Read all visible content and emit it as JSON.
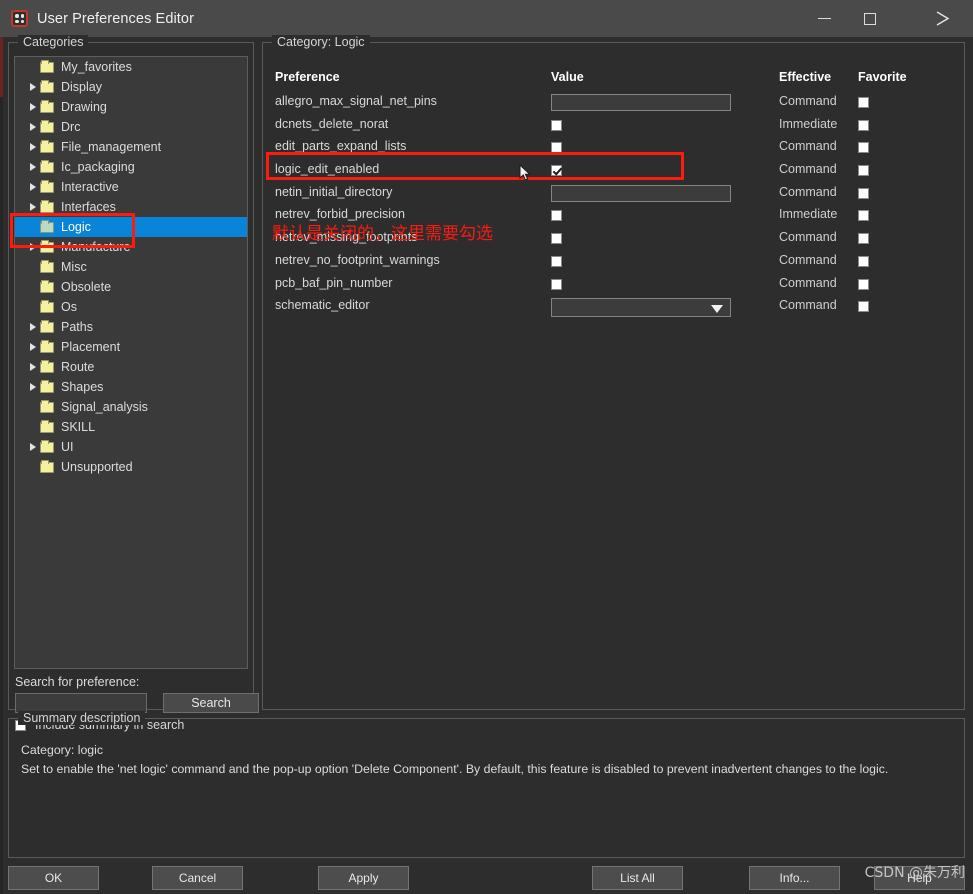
{
  "window": {
    "title": "User Preferences Editor",
    "icon": "app-preferences-icon",
    "minimize": "−",
    "maximize": "□",
    "close": "✕"
  },
  "categories_panel": {
    "legend": "Categories",
    "tree": [
      {
        "label": "My_favorites",
        "expandable": false,
        "selected": false
      },
      {
        "label": "Display",
        "expandable": true,
        "selected": false
      },
      {
        "label": "Drawing",
        "expandable": true,
        "selected": false
      },
      {
        "label": "Drc",
        "expandable": true,
        "selected": false
      },
      {
        "label": "File_management",
        "expandable": true,
        "selected": false
      },
      {
        "label": "Ic_packaging",
        "expandable": true,
        "selected": false
      },
      {
        "label": "Interactive",
        "expandable": true,
        "selected": false
      },
      {
        "label": "Interfaces",
        "expandable": true,
        "selected": false
      },
      {
        "label": "Logic",
        "expandable": false,
        "selected": true
      },
      {
        "label": "Manufacture",
        "expandable": true,
        "selected": false
      },
      {
        "label": "Misc",
        "expandable": false,
        "selected": false
      },
      {
        "label": "Obsolete",
        "expandable": false,
        "selected": false
      },
      {
        "label": "Os",
        "expandable": false,
        "selected": false
      },
      {
        "label": "Paths",
        "expandable": true,
        "selected": false
      },
      {
        "label": "Placement",
        "expandable": true,
        "selected": false
      },
      {
        "label": "Route",
        "expandable": true,
        "selected": false
      },
      {
        "label": "Shapes",
        "expandable": true,
        "selected": false
      },
      {
        "label": "Signal_analysis",
        "expandable": false,
        "selected": false
      },
      {
        "label": "SKILL",
        "expandable": false,
        "selected": false
      },
      {
        "label": "UI",
        "expandable": true,
        "selected": false
      },
      {
        "label": "Unsupported",
        "expandable": false,
        "selected": false
      }
    ],
    "search_label": "Search for preference:",
    "search_value": "",
    "search_placeholder": "",
    "search_button": "Search",
    "include_summary_label": "Include summary in search",
    "include_summary_checked": false
  },
  "category_panel": {
    "legend_prefix": "Category:",
    "legend_value": "Logic",
    "legend": "Category:   Logic",
    "columns": {
      "preference": "Preference",
      "value": "Value",
      "effective": "Effective",
      "favorite": "Favorite"
    },
    "rows": [
      {
        "name": "allegro_max_signal_net_pins",
        "value_type": "text",
        "value": "",
        "effective": "Command",
        "favorite": false,
        "highlighted": false
      },
      {
        "name": "dcnets_delete_norat",
        "value_type": "checkbox",
        "checked": false,
        "effective": "Immediate",
        "favorite": false,
        "highlighted": false
      },
      {
        "name": "edit_parts_expand_lists",
        "value_type": "checkbox",
        "checked": false,
        "effective": "Command",
        "favorite": false,
        "highlighted": false
      },
      {
        "name": "logic_edit_enabled",
        "value_type": "checkbox",
        "checked": true,
        "effective": "Command",
        "favorite": false,
        "highlighted": true
      },
      {
        "name": "netin_initial_directory",
        "value_type": "text",
        "value": "",
        "effective": "Command",
        "favorite": false,
        "highlighted": false
      },
      {
        "name": "netrev_forbid_precision",
        "value_type": "checkbox",
        "checked": false,
        "effective": "Immediate",
        "favorite": false,
        "highlighted": false
      },
      {
        "name": "netrev_missing_footprints",
        "value_type": "checkbox",
        "checked": false,
        "effective": "Command",
        "favorite": false,
        "highlighted": false
      },
      {
        "name": "netrev_no_footprint_warnings",
        "value_type": "checkbox",
        "checked": false,
        "effective": "Command",
        "favorite": false,
        "highlighted": false
      },
      {
        "name": "pcb_baf_pin_number",
        "value_type": "checkbox",
        "checked": false,
        "effective": "Command",
        "favorite": false,
        "highlighted": false
      },
      {
        "name": "schematic_editor",
        "value_type": "combobox",
        "value": "",
        "effective": "Command",
        "favorite": false,
        "highlighted": false
      }
    ]
  },
  "summary_panel": {
    "legend": "Summary description",
    "line1": "Category: logic",
    "line2": "Set to enable the 'net logic' command and the pop-up option 'Delete Component'. By default, this feature is disabled to prevent inadvertent changes to the logic."
  },
  "buttons": {
    "ok": "OK",
    "cancel": "Cancel",
    "apply": "Apply",
    "list_all": "List All",
    "info": "Info...",
    "help": "Help"
  },
  "annotations": {
    "red_note": "默认是关闭的，这里需要勾选",
    "watermark": "CSDN @朱万利",
    "accent_red": "#fb1b0f",
    "selection_blue": "#0a84d8"
  }
}
